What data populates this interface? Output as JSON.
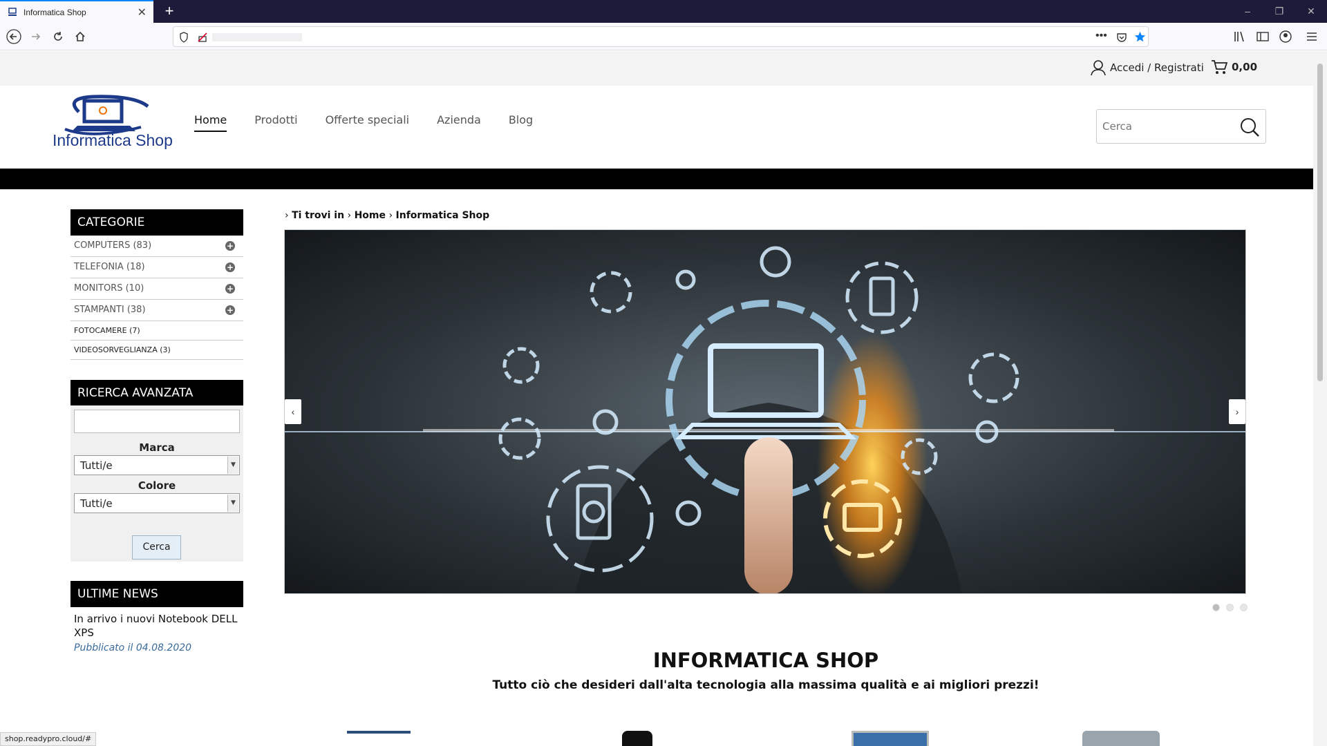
{
  "browser": {
    "tab_title": "Informatica Shop",
    "new_tab": "+",
    "window_controls": [
      "–",
      "❐",
      "✕"
    ]
  },
  "account": {
    "label": "Accedi / Registrati",
    "cart_total": "0,00"
  },
  "header": {
    "logo_text": "Informatica Shop",
    "menu": [
      {
        "label": "Home",
        "active": true
      },
      {
        "label": "Prodotti"
      },
      {
        "label": "Offerte speciali"
      },
      {
        "label": "Azienda"
      },
      {
        "label": "Blog"
      }
    ],
    "search_placeholder": "Cerca"
  },
  "sidebar": {
    "categories_title": "CATEGORIE",
    "categories": [
      {
        "label": "COMPUTERS (83)",
        "expandable": true
      },
      {
        "label": "TELEFONIA (18)",
        "expandable": true
      },
      {
        "label": "MONITORS (10)",
        "expandable": true
      },
      {
        "label": "STAMPANTI (38)",
        "expandable": true
      },
      {
        "label": "FOTOCAMERE (7)",
        "expandable": false
      },
      {
        "label": "VIDEOSORVEGLIANZA (3)",
        "expandable": false
      }
    ],
    "advanced_title": "RICERCA AVANZATA",
    "marca_label": "Marca",
    "marca_value": "Tutti/e",
    "colore_label": "Colore",
    "colore_value": "Tutti/e",
    "search_button": "Cerca",
    "news_title": "ULTIME NEWS",
    "news_item": "In arrivo i nuovi Notebook DELL XPS",
    "news_date": "Pubblicato il 04.08.2020"
  },
  "main": {
    "breadcrumb_prefix": "Ti trovi in",
    "breadcrumb_home": "Home",
    "breadcrumb_current": "Informatica Shop",
    "slider_dots": 3,
    "title": "INFORMATICA SHOP",
    "subtitle": "Tutto ciò che desideri dall'alta tecnologia alla massima qualità e ai migliori prezzi!"
  },
  "status_url": "shop.readypro.cloud/#",
  "colors": {
    "accent": "#0a84ff",
    "logo_blue": "#1d3a8a",
    "tab_bar": "#1c1b3a"
  }
}
